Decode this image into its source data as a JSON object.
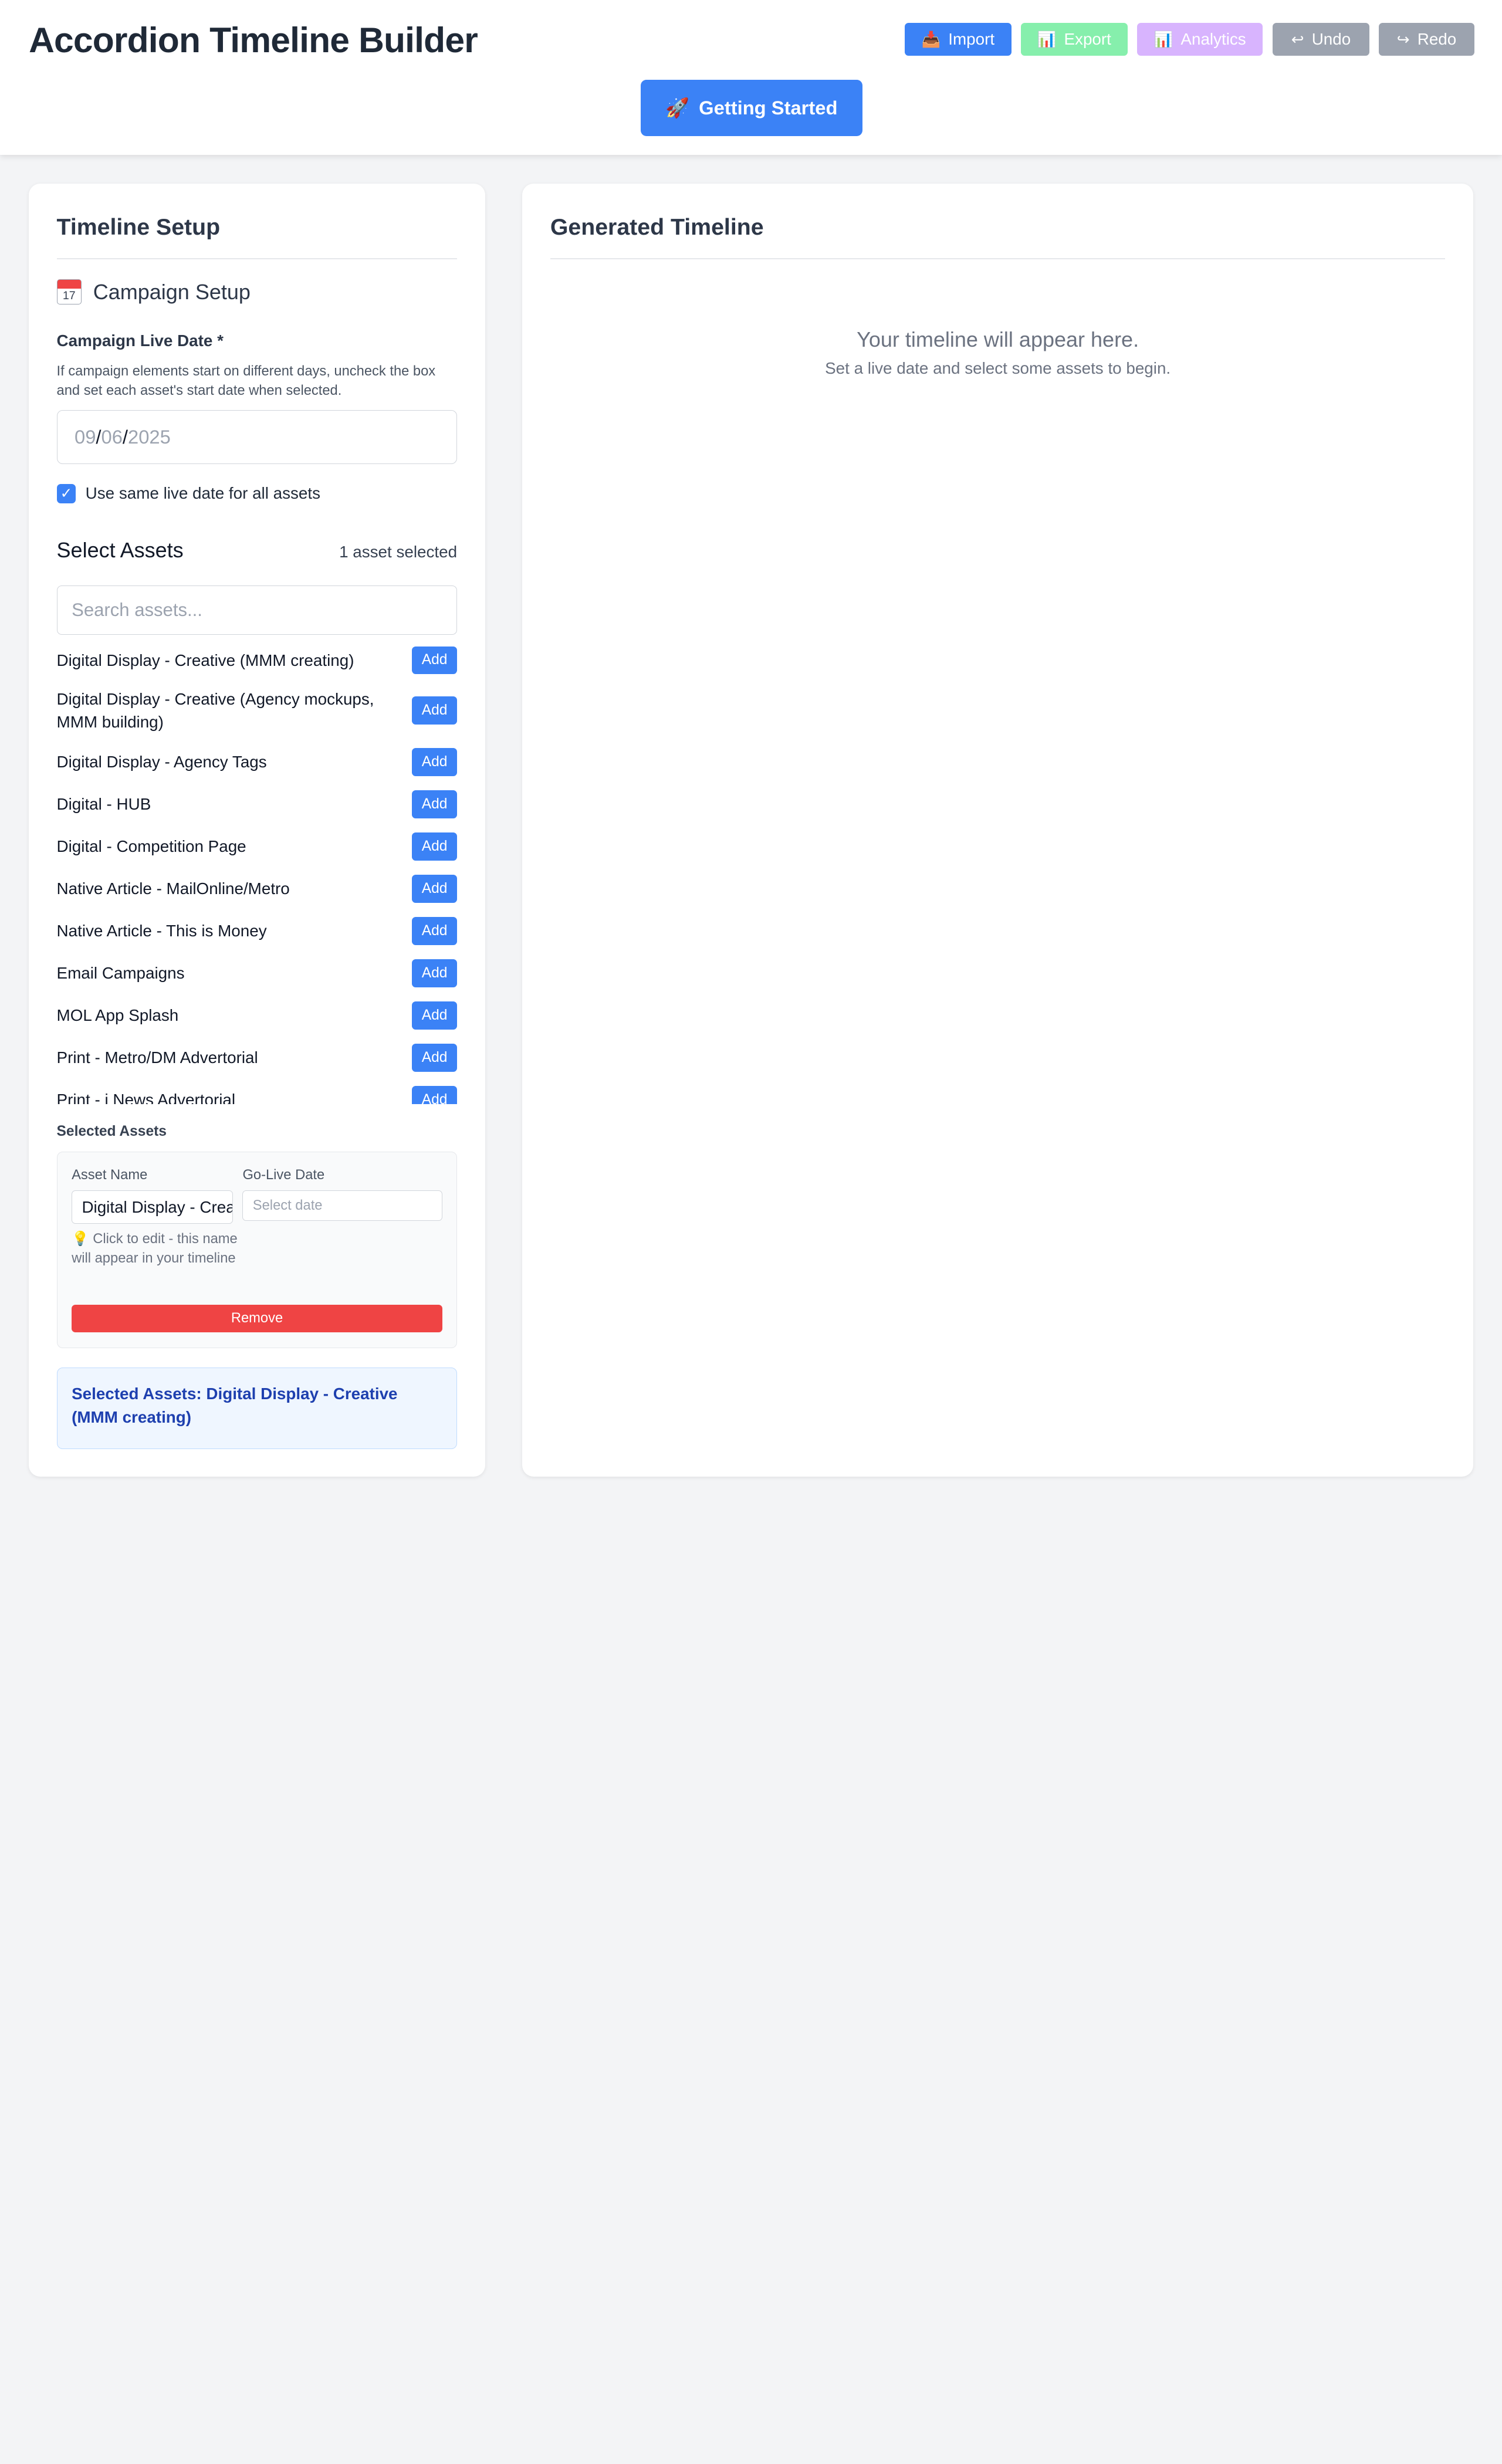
{
  "header": {
    "title": "Accordion Timeline Builder",
    "toolbar": {
      "import": {
        "icon": "📥",
        "label": "Import"
      },
      "export": {
        "icon": "📊",
        "label": "Export"
      },
      "analytics": {
        "icon": "📊",
        "label": "Analytics"
      },
      "undo": {
        "icon": "↩",
        "label": "Undo"
      },
      "redo": {
        "icon": "↪",
        "label": "Redo"
      }
    },
    "getting_started": {
      "icon": "🚀",
      "label": "Getting Started"
    }
  },
  "setup": {
    "title": "Timeline Setup",
    "campaign": {
      "icon_day": "17",
      "title": "Campaign Setup",
      "live_date_label": "Campaign Live Date *",
      "help": "If campaign elements start on different days, uncheck the box and set each asset's start date when selected.",
      "date": {
        "month": "09",
        "sep1": "/",
        "day": "06",
        "sep2": "/",
        "year": "2025"
      },
      "same_date_checkbox": {
        "checked": true,
        "label": "Use same live date for all assets"
      }
    },
    "assets": {
      "title": "Select Assets",
      "count": "1 asset selected",
      "search_placeholder": "Search assets...",
      "add_label": "Add",
      "items": [
        "Digital Display - Creative (MMM creating)",
        "Digital Display - Creative (Agency mockups, MMM building)",
        "Digital Display - Agency Tags",
        "Digital - HUB",
        "Digital - Competition Page",
        "Native Article - MailOnline/Metro",
        "Native Article - This is Money",
        "Email Campaigns",
        "MOL App Splash",
        "Print - Metro/DM Advertorial",
        "Print - i News Advertorial"
      ]
    },
    "selected": {
      "title": "Selected Assets",
      "asset_name_label": "Asset Name",
      "go_live_label": "Go-Live Date",
      "asset_name_value": "Digital Display - Creative (MMM creating)",
      "date_placeholder": "Select date",
      "hint_icon": "💡",
      "hint": "Click to edit - this name will appear in your timeline",
      "remove_label": "Remove"
    },
    "summary": "Selected Assets: Digital Display - Creative (MMM creating)"
  },
  "timeline": {
    "title": "Generated Timeline",
    "empty_title": "Your timeline will appear here.",
    "empty_sub": "Set a live date and select some assets to begin."
  },
  "colors": {
    "primary": "#3b82f6",
    "export": "#86efac",
    "analytics": "#d8b4fe",
    "neutral": "#9ca3af",
    "danger": "#ef4444"
  }
}
